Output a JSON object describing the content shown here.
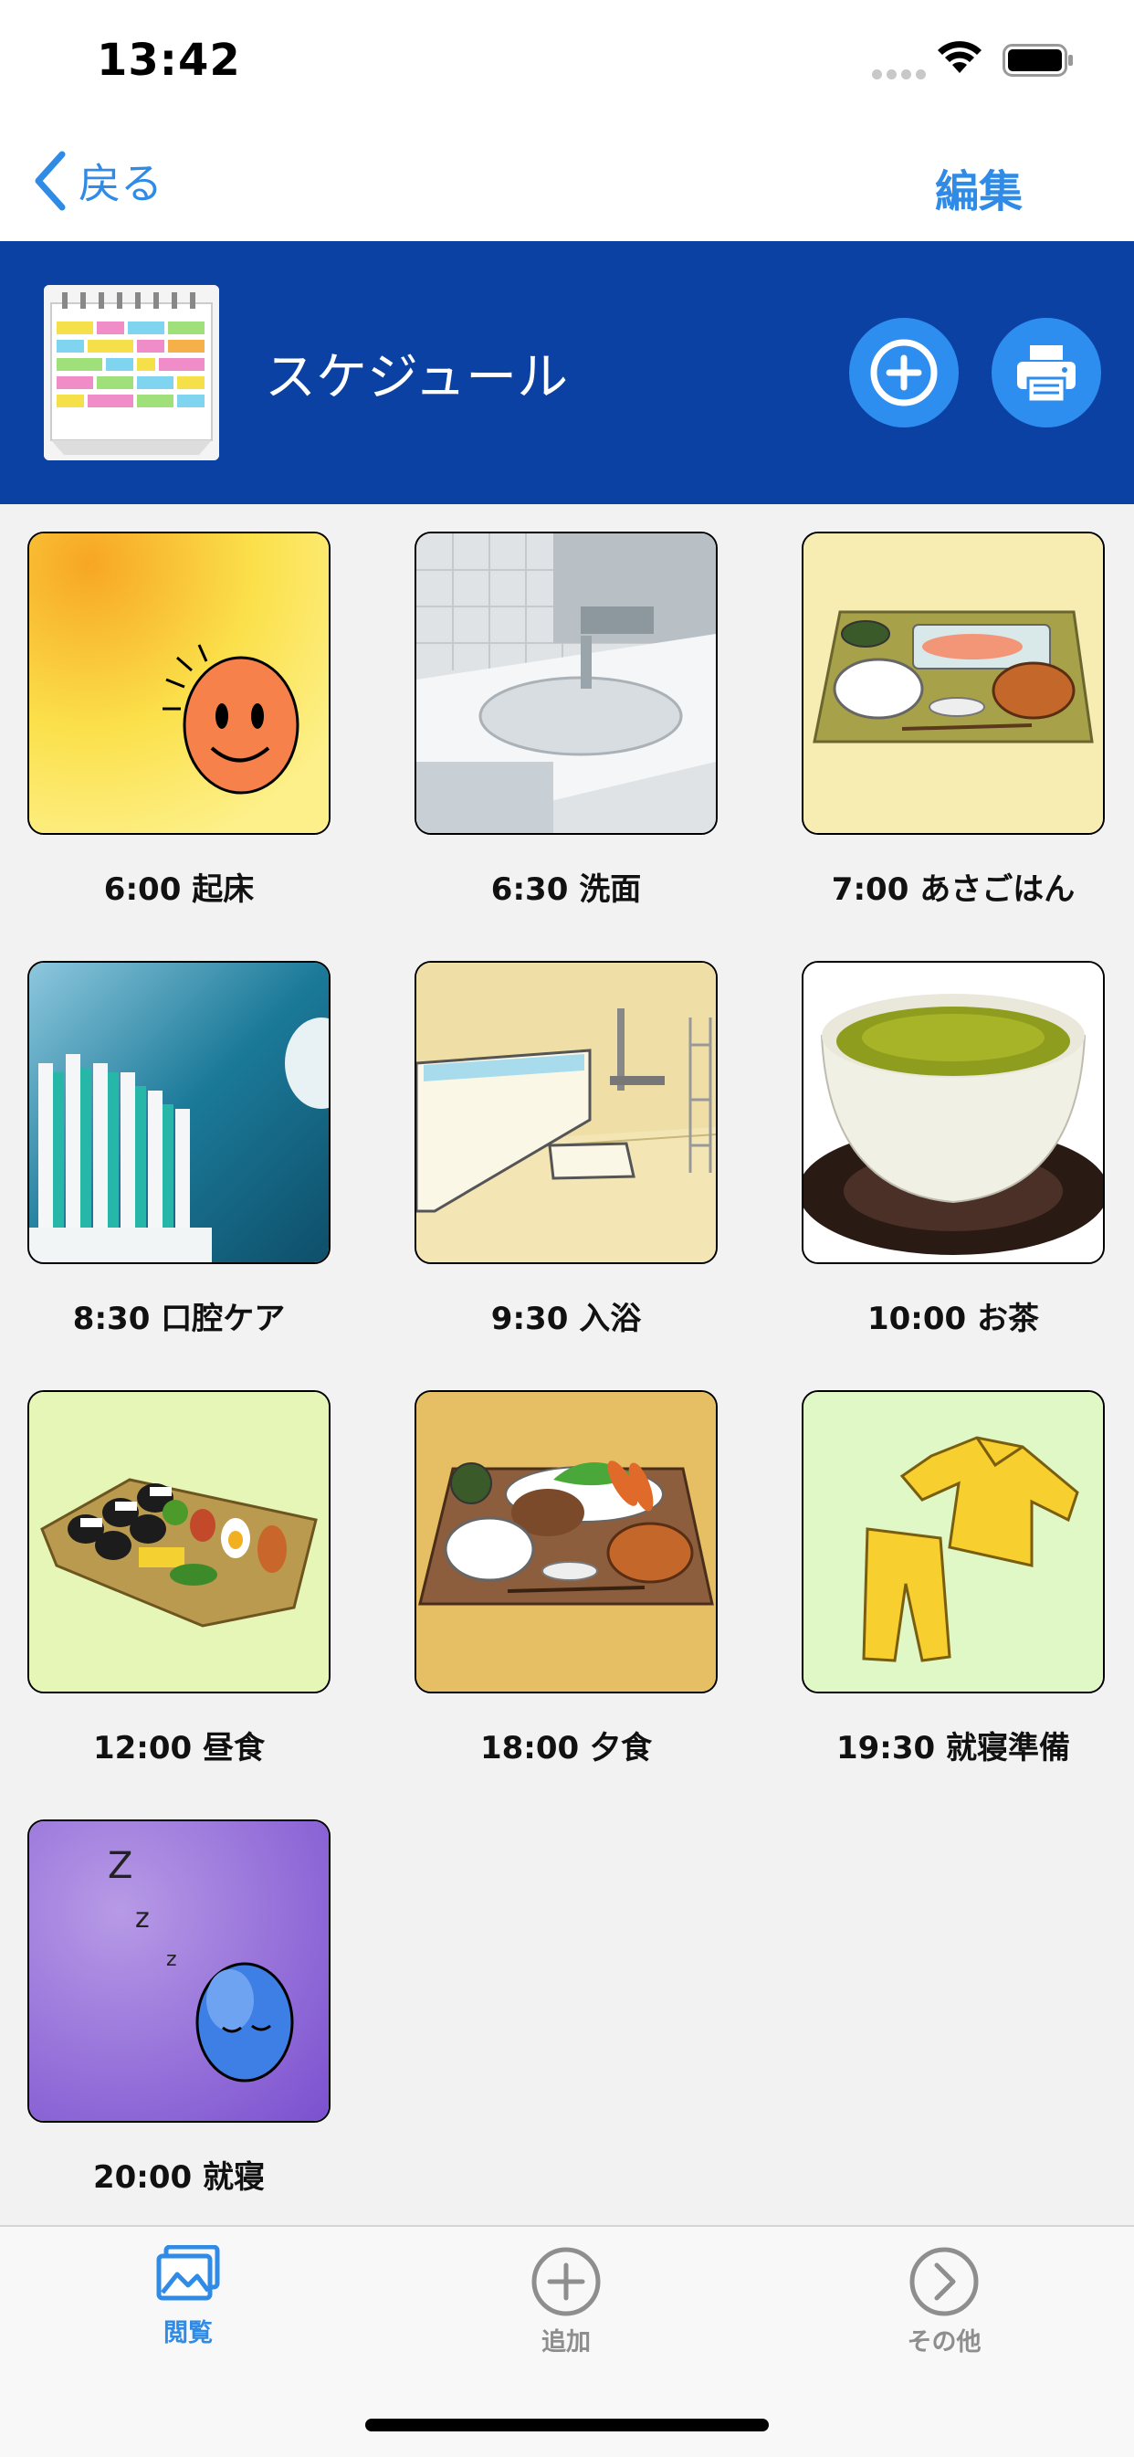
{
  "status_bar": {
    "time": "13:42"
  },
  "nav": {
    "back_label": "戻る",
    "edit_label": "編集"
  },
  "header": {
    "title": "スケジュール"
  },
  "schedule": [
    {
      "label": "6:00 起床",
      "image": "sun-face"
    },
    {
      "label": "6:30 洗面",
      "image": "wash-basin"
    },
    {
      "label": "7:00 あさごはん",
      "image": "breakfast-tray"
    },
    {
      "label": "8:30 口腔ケア",
      "image": "toothbrush"
    },
    {
      "label": "9:30 入浴",
      "image": "bathtub"
    },
    {
      "label": "10:00 お茶",
      "image": "green-tea"
    },
    {
      "label": "12:00 昼食",
      "image": "bento-box"
    },
    {
      "label": "18:00 夕食",
      "image": "dinner-tray"
    },
    {
      "label": "19:30 就寝準備",
      "image": "pajamas"
    },
    {
      "label": "20:00 就寝",
      "image": "sleeping-moon"
    }
  ],
  "tabs": [
    {
      "label": "閲覧",
      "icon": "photo-icon",
      "active": true
    },
    {
      "label": "追加",
      "icon": "plus-circle-icon",
      "active": false
    },
    {
      "label": "その他",
      "icon": "chevron-circle-icon",
      "active": false
    }
  ],
  "colors": {
    "accent": "#2f8be6",
    "header_bg": "#0b41a3",
    "inactive": "#8e8e8e"
  }
}
